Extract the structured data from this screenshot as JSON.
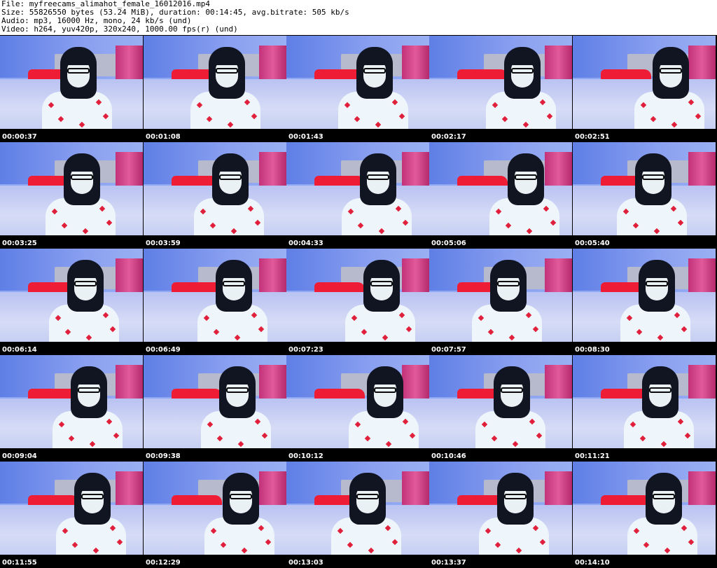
{
  "header": {
    "file_line": "File: myfreecams_alimahot_female_16012016.mp4",
    "size_line": "Size: 55826550 bytes (53.24 MiB), duration: 00:14:45, avg.bitrate: 505 kb/s",
    "audio_line": "Audio: mp3, 16000 Hz, mono, 24 kb/s (und)",
    "video_line": "Video: h264, yuv420p, 320x240, 1000.00 fps(r) (und)"
  },
  "colors": {
    "background": "#000000",
    "header_background": "#ffffff",
    "timestamp_text": "#ffffff",
    "pillow": "#ee1c34",
    "wall": "#6d8df2",
    "curtain": "#d0408a"
  },
  "thumbnails": [
    {
      "timestamp": "00:00:37"
    },
    {
      "timestamp": "00:01:08"
    },
    {
      "timestamp": "00:01:43"
    },
    {
      "timestamp": "00:02:17"
    },
    {
      "timestamp": "00:02:51"
    },
    {
      "timestamp": "00:03:25"
    },
    {
      "timestamp": "00:03:59"
    },
    {
      "timestamp": "00:04:33"
    },
    {
      "timestamp": "00:05:06"
    },
    {
      "timestamp": "00:05:40"
    },
    {
      "timestamp": "00:06:14"
    },
    {
      "timestamp": "00:06:49"
    },
    {
      "timestamp": "00:07:23"
    },
    {
      "timestamp": "00:07:57"
    },
    {
      "timestamp": "00:08:30"
    },
    {
      "timestamp": "00:09:04"
    },
    {
      "timestamp": "00:09:38"
    },
    {
      "timestamp": "00:10:12"
    },
    {
      "timestamp": "00:10:46"
    },
    {
      "timestamp": "00:11:21"
    },
    {
      "timestamp": "00:11:55"
    },
    {
      "timestamp": "00:12:29"
    },
    {
      "timestamp": "00:13:03"
    },
    {
      "timestamp": "00:13:37"
    },
    {
      "timestamp": "00:14:10"
    }
  ]
}
